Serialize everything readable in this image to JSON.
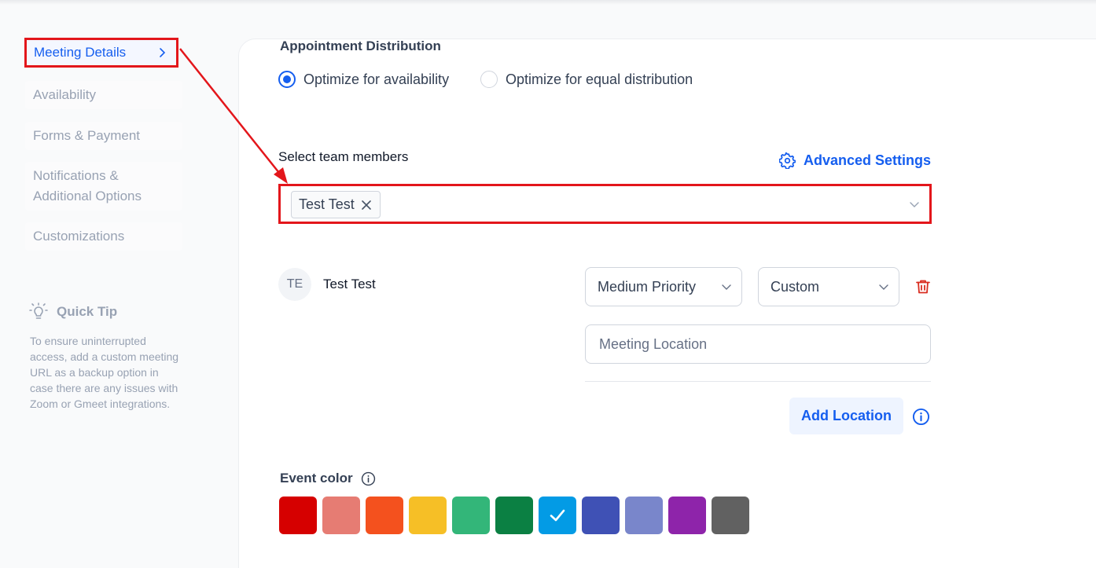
{
  "sidebar": {
    "items": [
      {
        "label": "Meeting Details"
      },
      {
        "label": "Availability"
      },
      {
        "label": "Forms & Payment"
      },
      {
        "label": "Notifications &"
      },
      {
        "label": "Additional Options"
      },
      {
        "label": "Customizations"
      }
    ],
    "quick_tip": {
      "title": "Quick Tip",
      "text": "To ensure uninterrupted access, add a custom meeting URL as a backup option in case there are any issues with Zoom or Gmeet integrations."
    }
  },
  "distribution": {
    "title": "Appointment Distribution",
    "options": [
      {
        "label": "Optimize for availability",
        "checked": true
      },
      {
        "label": "Optimize for equal distribution",
        "checked": false
      }
    ]
  },
  "team": {
    "label": "Select team members",
    "advanced_settings": "Advanced Settings",
    "selected_chip": "Test Test"
  },
  "member": {
    "initials": "TE",
    "name": "Test Test",
    "priority": "Medium Priority",
    "type": "Custom",
    "location_placeholder": "Meeting Location",
    "add_location": "Add Location"
  },
  "event_color": {
    "label": "Event color",
    "colors": [
      "#d60000",
      "#e67c73",
      "#f4511e",
      "#f6bf26",
      "#33b679",
      "#0b8043",
      "#039be5",
      "#3f51b5",
      "#7986cb",
      "#8e24aa",
      "#616161"
    ],
    "selected_index": 6
  },
  "annotation_color": "#e3161b"
}
